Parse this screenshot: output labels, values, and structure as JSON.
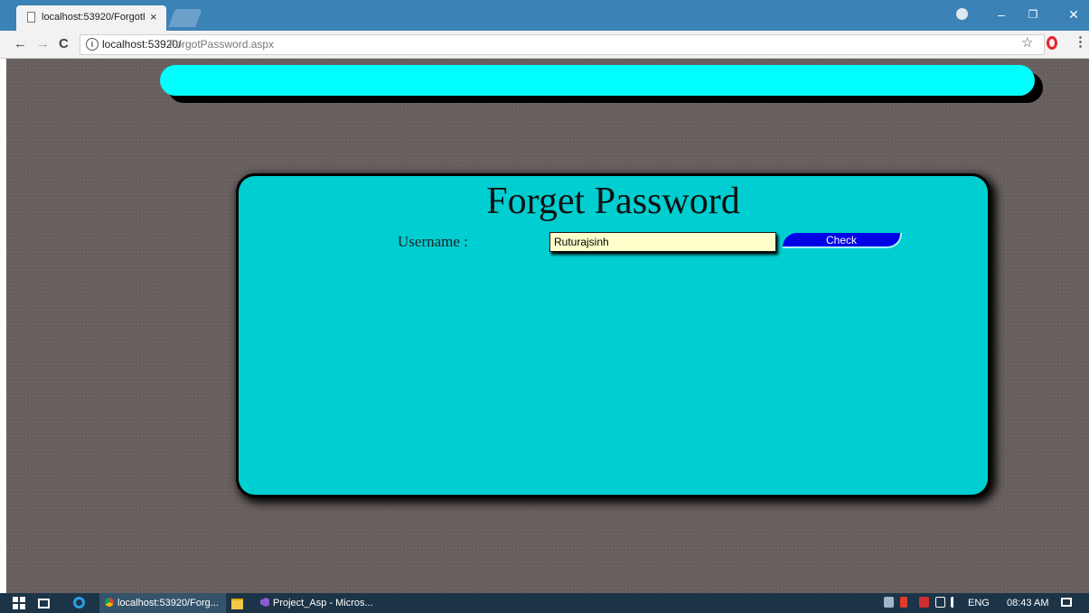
{
  "browser": {
    "tab_title": "localhost:53920/ForgotP",
    "tab_close": "×",
    "url_host": "localhost:53920/",
    "url_path": "ForgotPassword.aspx",
    "nav": {
      "back": "←",
      "forward": "→",
      "reload": "C"
    },
    "star": "☆",
    "menu": "⋮",
    "window_controls": {
      "minimize": "–",
      "restore": "❐",
      "close": "✕"
    }
  },
  "page": {
    "title": "Forget Password",
    "username_label": "Username :",
    "username_value": "Ruturajsinh",
    "check_button": "Check"
  },
  "colors": {
    "page_background": "#675f5e",
    "banner": "#00ffff",
    "panel": "#00ced1",
    "input_background": "#ffffcc",
    "button": "#0000e6"
  },
  "taskbar": {
    "chrome_app_label": "localhost:53920/Forg...",
    "vs_app_label": "Project_Asp - Micros...",
    "language": "ENG",
    "time": "08:43 AM"
  }
}
